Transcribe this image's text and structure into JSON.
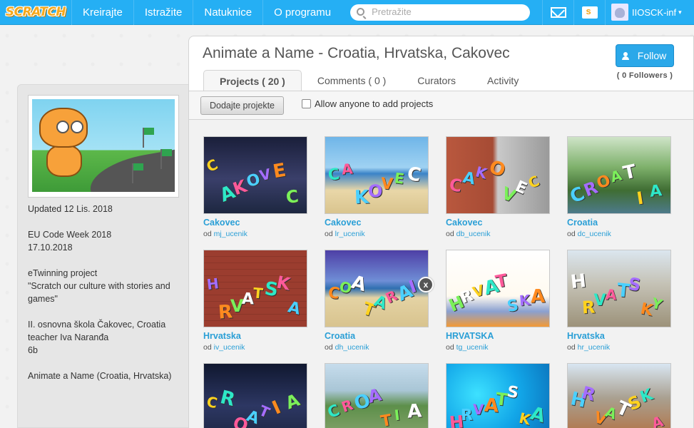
{
  "nav": {
    "logo": "SCRATCH",
    "items": [
      "Kreirajte",
      "Istražite",
      "Natuknice",
      "O programu"
    ],
    "search_placeholder": "Pretražite",
    "username": "IIOSCK-inf",
    "caret": "▾"
  },
  "studio": {
    "title": "Animate a Name - Croatia, Hrvatska, Cakovec",
    "follow_label": "Follow",
    "followers": "( 0 Followers )",
    "tabs": [
      "Projects ( 20 )",
      "Comments ( 0 )",
      "Curators",
      "Activity"
    ],
    "add_projects_label": "Dodajte projekte",
    "allow_anyone_label": "Allow anyone to add projects"
  },
  "sidebar": {
    "updated": "Updated 12 Lis. 2018",
    "desc": [
      "EU Code Week 2018\n17.10.2018",
      "eTwinning project\n\"Scratch our culture with stories and games\"",
      "II. osnovna škola Čakovec, Croatia\nteacher Iva Naranđa\n6b",
      "Animate a Name (Croatia, Hrvatska)"
    ]
  },
  "projects": [
    {
      "title": "Cakovec",
      "by": "od",
      "user": "mj_ucenik"
    },
    {
      "title": "Cakovec",
      "by": "od",
      "user": "lr_ucenik"
    },
    {
      "title": "Cakovec",
      "by": "od",
      "user": "db_ucenik"
    },
    {
      "title": "Croatia",
      "by": "od",
      "user": "dc_ucenik"
    },
    {
      "title": "Hrvatska",
      "by": "od",
      "user": "iv_ucenik"
    },
    {
      "title": "Croatia",
      "by": "od",
      "user": "dh_ucenik"
    },
    {
      "title": "HRVATSKA",
      "by": "od",
      "user": "tg_ucenik"
    },
    {
      "title": "Hrvatska",
      "by": "od",
      "user": "hr_ucenik"
    },
    {
      "title": "",
      "by": "",
      "user": ""
    },
    {
      "title": "",
      "by": "",
      "user": ""
    },
    {
      "title": "",
      "by": "",
      "user": ""
    },
    {
      "title": "",
      "by": "",
      "user": ""
    }
  ],
  "thumb_letters": [
    "CAKOVEC",
    "CAKOVEC",
    "CAKOVEC",
    "CROATIA",
    "HRVATSKA",
    "COATA RAI",
    "HRVATSKA",
    "HRVATSKY",
    "CROATIA",
    "CROATIA",
    "HRVATSKA",
    "HRVATSKA"
  ],
  "close_label": "x"
}
